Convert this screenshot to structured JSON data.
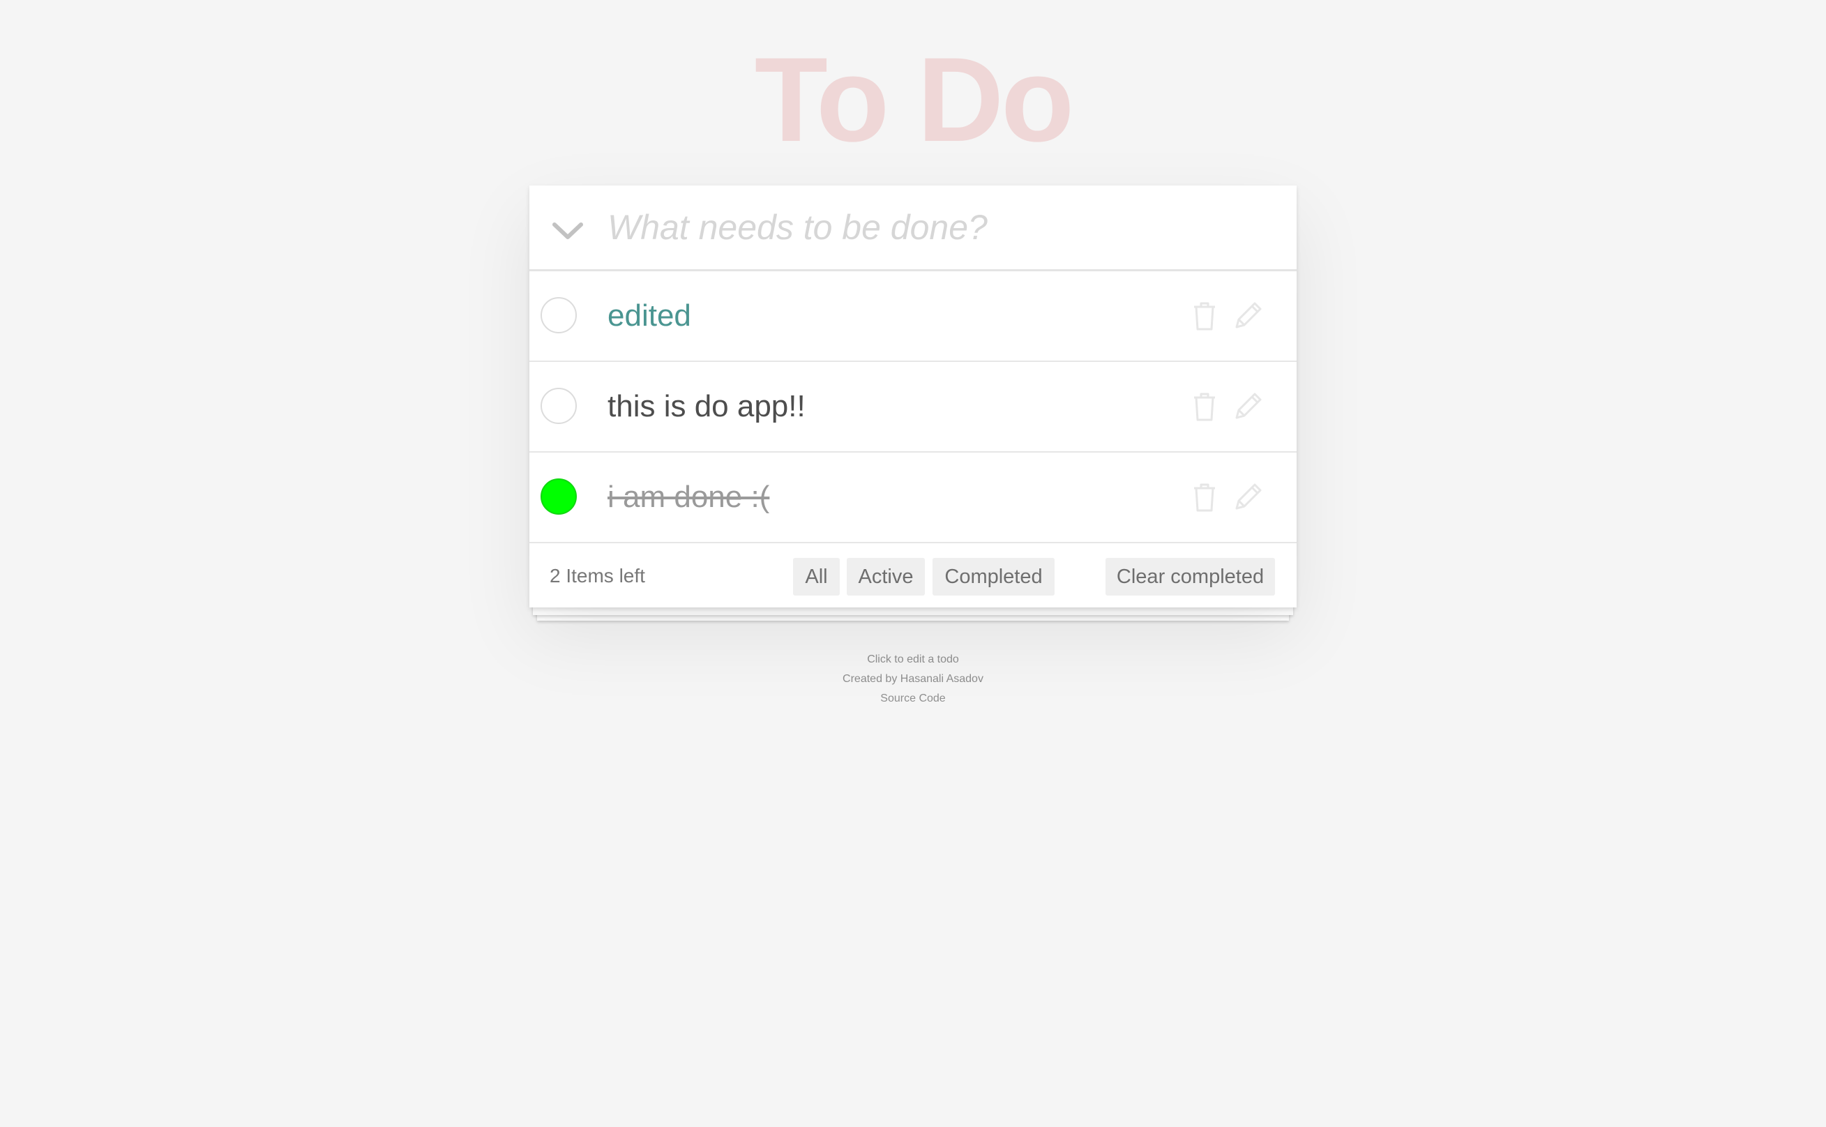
{
  "app": {
    "title": "To Do"
  },
  "new_todo": {
    "placeholder": "What needs to be done?",
    "value": ""
  },
  "todos": [
    {
      "text": "edited",
      "completed": false,
      "state": "edited"
    },
    {
      "text": "this is do app!!",
      "completed": false,
      "state": "active"
    },
    {
      "text": "i am done :(",
      "completed": true,
      "state": "completed"
    }
  ],
  "footer": {
    "items_left": "2 Items left",
    "filters": {
      "all": "All",
      "active": "Active",
      "completed": "Completed"
    },
    "clear_completed": "Clear completed"
  },
  "info": {
    "hint": "Click to edit a todo",
    "credit": "Created by Hasanali Asadov",
    "source_link": "Source Code"
  },
  "icons": {
    "toggle_all": "chevron-down-icon",
    "delete": "trash-icon",
    "edit": "pencil-icon"
  },
  "colors": {
    "background": "#f5f5f5",
    "title": "#efd7d7",
    "edited_text": "#4a9591",
    "completed_check": "#00ff00",
    "icon": "#e6e6e6"
  }
}
